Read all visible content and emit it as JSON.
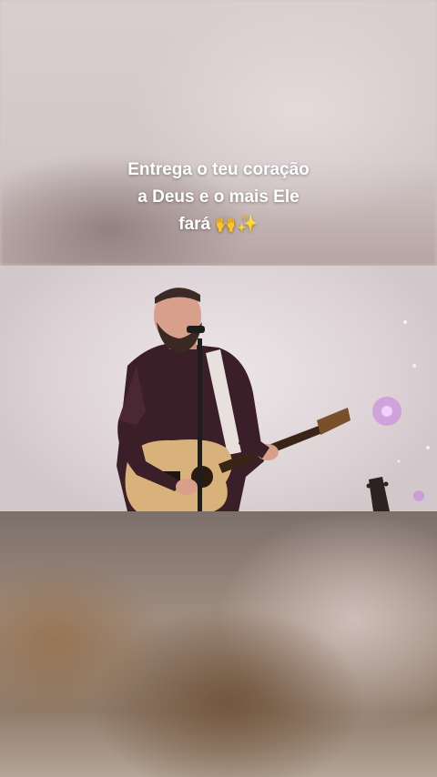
{
  "caption": {
    "line1": "Entrega o teu coração",
    "line2": "a Deus e o mais Ele",
    "line3": "fará 🙌✨"
  },
  "icons": {
    "performer": "performer-illustration",
    "guitar": "acoustic-guitar-icon",
    "microphone": "microphone-icon"
  },
  "colors": {
    "caption_text": "#ffffff",
    "shirt": "#3a1e28",
    "guitar_body": "#d8b27a"
  }
}
